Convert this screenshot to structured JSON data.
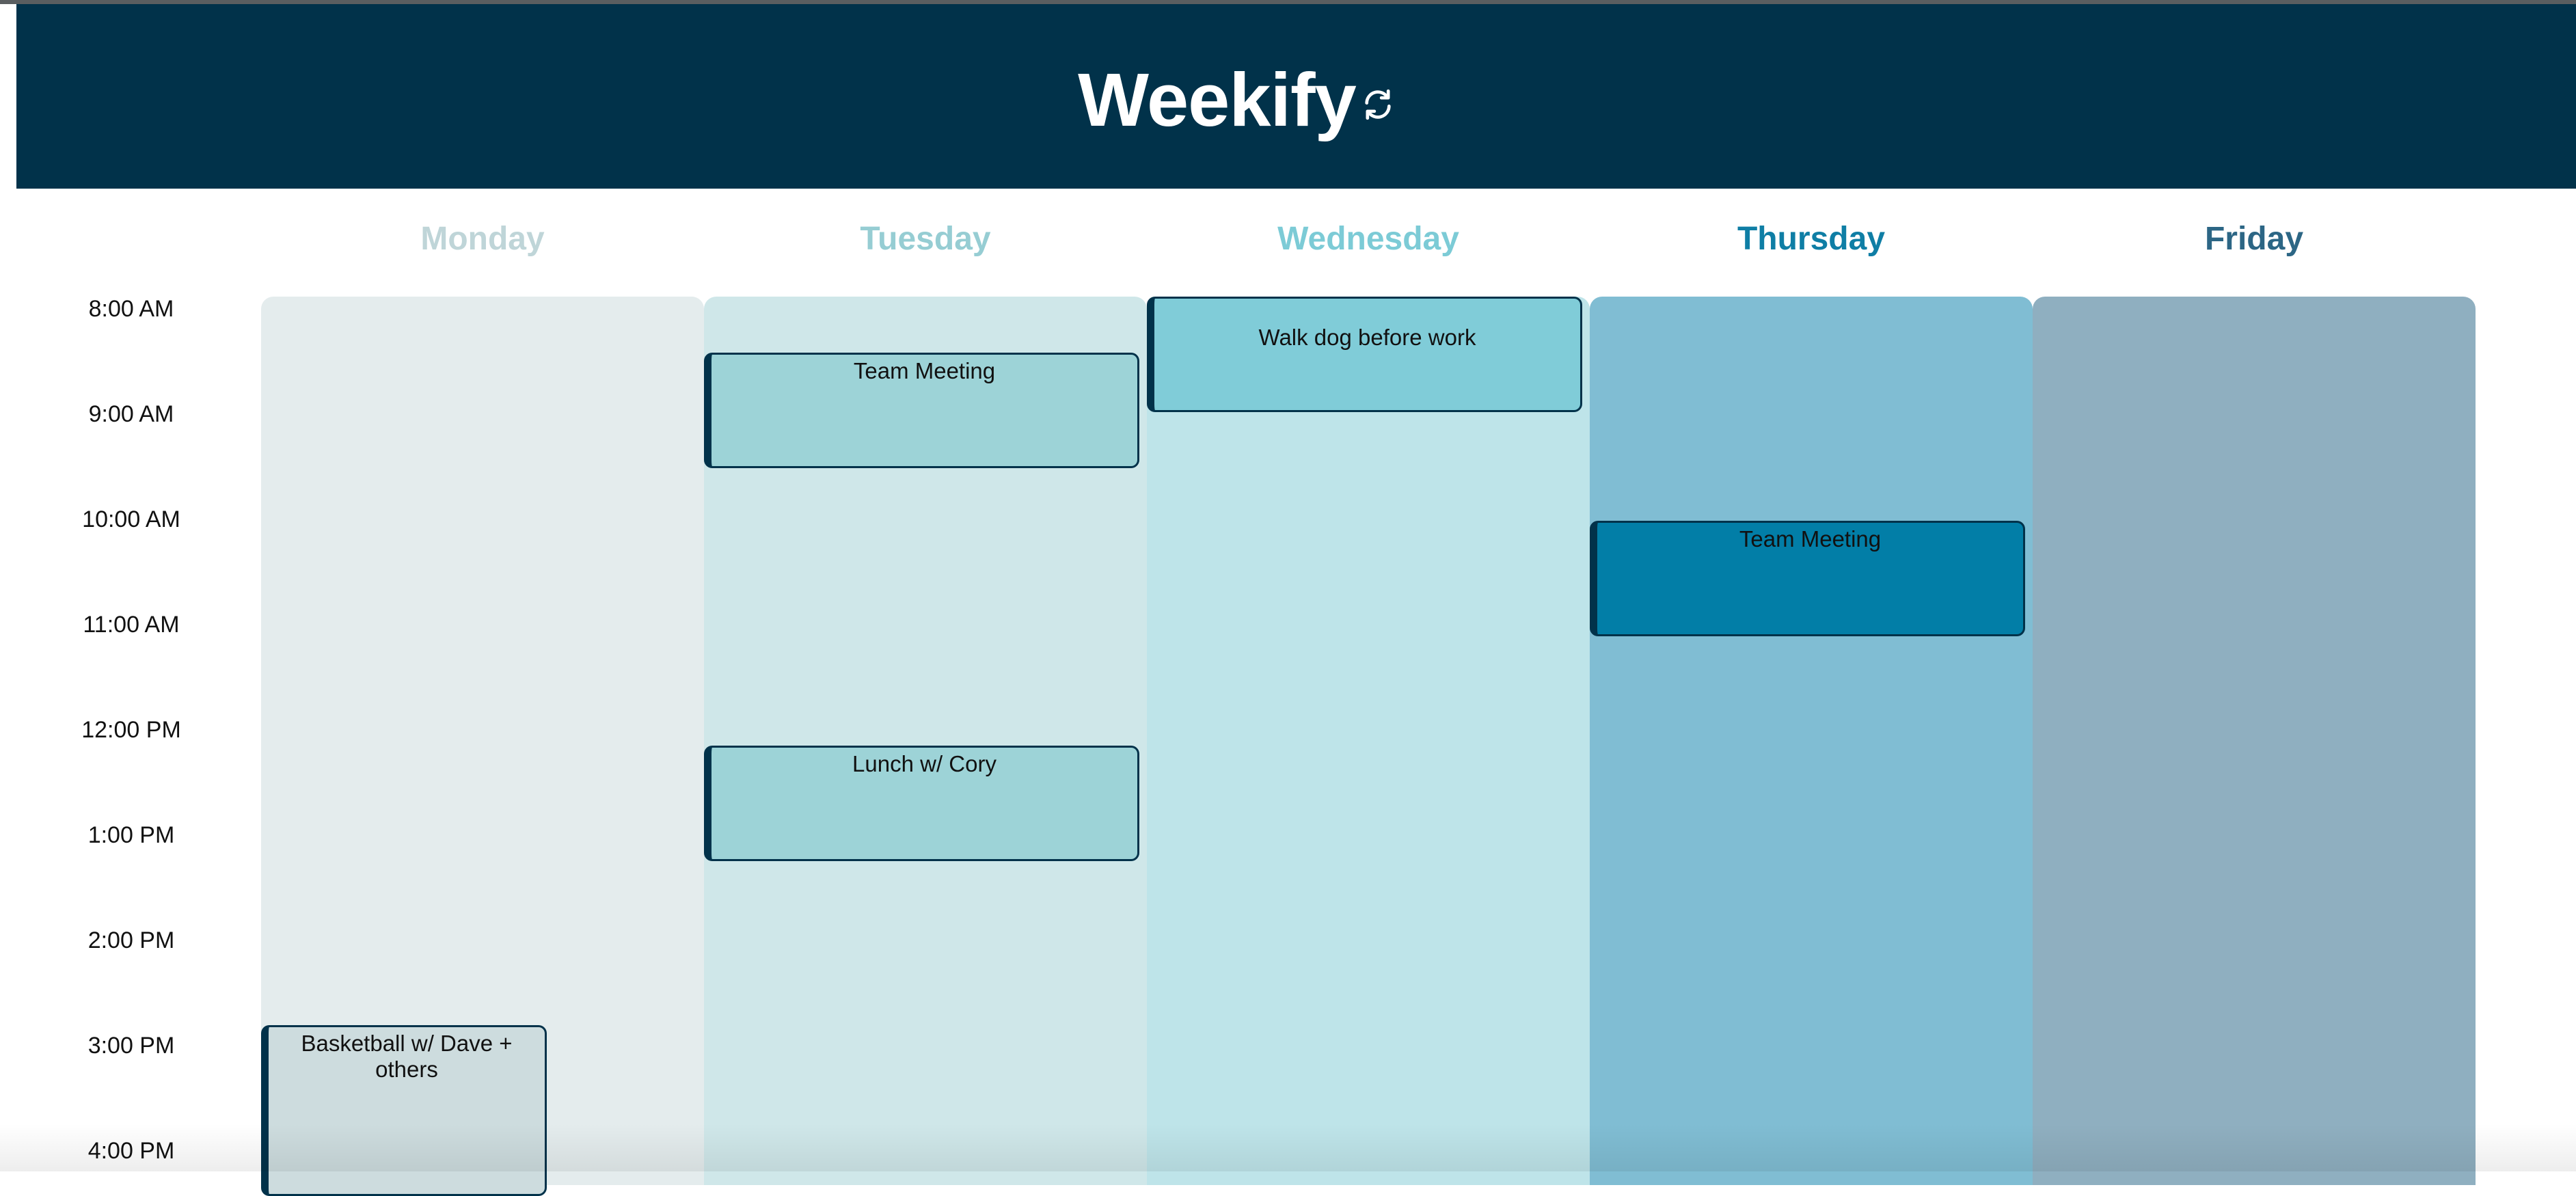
{
  "app": {
    "title": "Weekify",
    "refresh_icon": "refresh-icon"
  },
  "days": [
    {
      "name": "Monday",
      "header_color": "#bfd5d8",
      "column_color": "#e4eced"
    },
    {
      "name": "Tuesday",
      "header_color": "#96cdd3",
      "column_color": "#cfe7e9"
    },
    {
      "name": "Wednesday",
      "header_color": "#7ccbd6",
      "column_color": "#bee4e9"
    },
    {
      "name": "Thursday",
      "header_color": "#0f7ea5",
      "column_color": "#80bdd3"
    },
    {
      "name": "Friday",
      "header_color": "#2c6685",
      "column_color": "#8fafc0"
    }
  ],
  "times": [
    "8:00 AM",
    "9:00 AM",
    "10:00 AM",
    "11:00 AM",
    "12:00 PM",
    "1:00 PM",
    "2:00 PM",
    "3:00 PM",
    "4:00 PM"
  ],
  "events": [
    {
      "title": "Team Meeting",
      "day": "Tuesday",
      "start": "8:30 AM",
      "end": "9:30 AM",
      "color": "#9dd3d7"
    },
    {
      "title": "Lunch w/ Cory",
      "day": "Tuesday",
      "start": "12:15 PM",
      "end": "1:15 PM",
      "color": "#9dd3d7"
    },
    {
      "title": "Walk dog before work",
      "day": "Wednesday",
      "start": "8:00 AM",
      "end": "9:00 AM",
      "color": "#80ccd8"
    },
    {
      "title": "Team Meeting",
      "day": "Thursday",
      "start": "10:10 AM",
      "end": "11:10 AM",
      "color": "#027ea7"
    },
    {
      "title": "Basketball w/ Dave + others",
      "day": "Monday",
      "start": "2:55 PM",
      "end": "4:00 PM",
      "color": "#cddcde"
    }
  ]
}
